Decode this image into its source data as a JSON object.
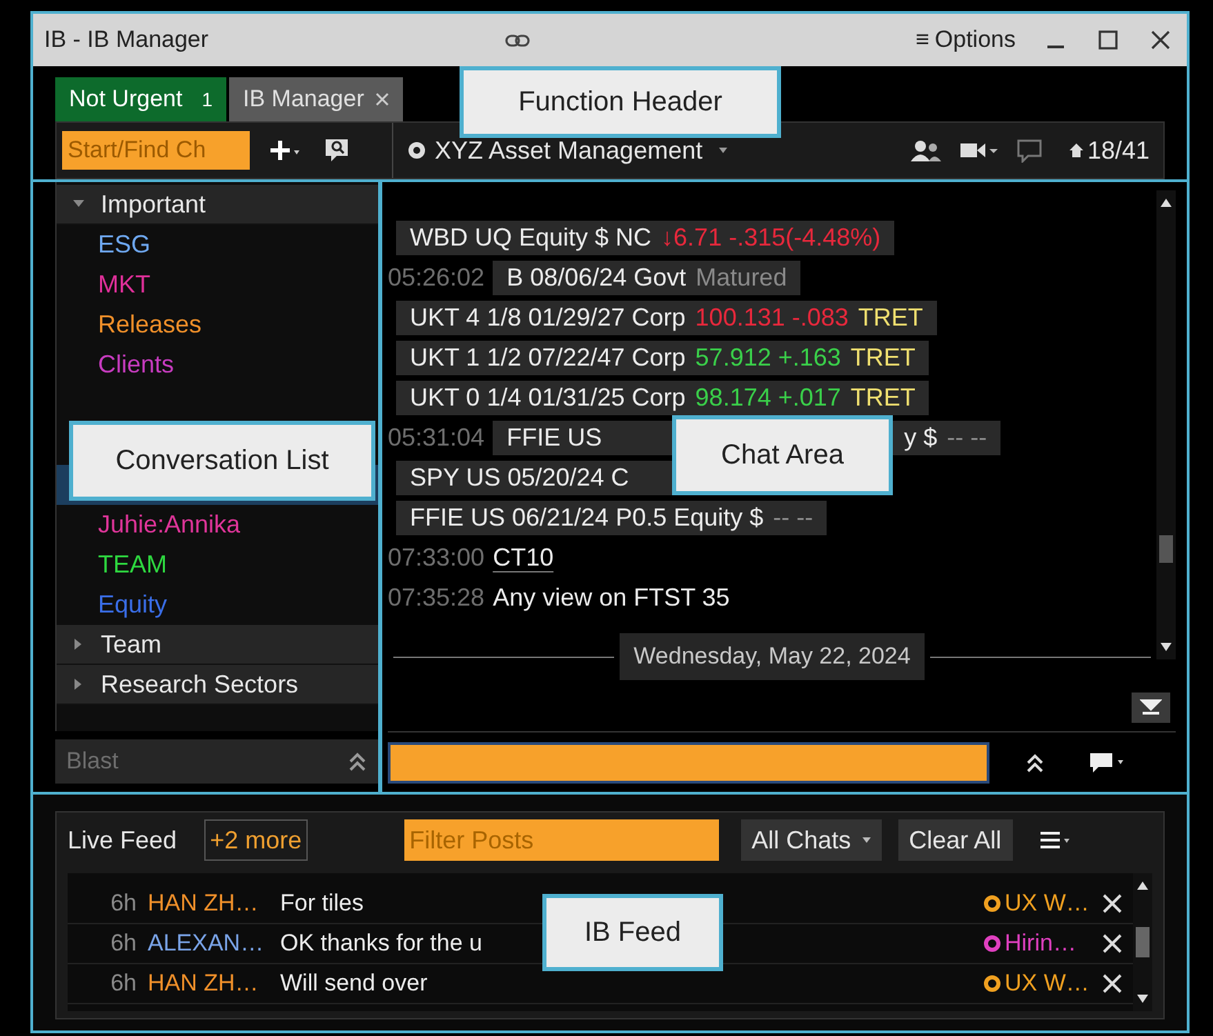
{
  "window": {
    "title": "IB - IB Manager",
    "menu_glyph": "≡",
    "options": "Options"
  },
  "tabs": [
    {
      "label": "Not Urgent",
      "count": "1",
      "kind": "badge"
    },
    {
      "label": "IB Manager",
      "kind": "function"
    }
  ],
  "toolbar": {
    "search_placeholder": "Start/Find Ch"
  },
  "chat_header": {
    "title": "XYZ Asset Management",
    "counter": "18/41"
  },
  "conversation_list": {
    "groups": [
      {
        "label": "Important",
        "expanded": true,
        "children": [
          {
            "kind": "chat",
            "label": "ESG",
            "color": "#6fa8f0",
            "selected": false
          },
          {
            "kind": "chat",
            "label": "MKT",
            "color": "#e0309a",
            "selected": false
          },
          {
            "kind": "chat",
            "label": "Releases",
            "color": "#f0902a",
            "selected": false
          },
          {
            "kind": "chat",
            "label": "Clients",
            "color": "#c83cc0",
            "selected": false
          },
          {
            "kind": "hidden"
          },
          {
            "kind": "chat",
            "selected": true
          },
          {
            "kind": "chat",
            "label": "Juhie:Annika",
            "color": "#e0359a",
            "selected": false
          },
          {
            "kind": "chat",
            "label": "TEAM",
            "color": "#2ed840",
            "selected": false
          },
          {
            "kind": "chat",
            "label": "Equity",
            "color": "#3a6ee8",
            "selected": false
          }
        ]
      },
      {
        "label": "Team",
        "expanded": false
      },
      {
        "label": "Research Sectors",
        "expanded": false
      }
    ],
    "blast_placeholder": "Blast"
  },
  "messages": [
    {
      "kind": "quote",
      "segments": [
        {
          "text": "WBD  UQ Equity $  NC",
          "kind": "security"
        },
        {
          "text": "↓6.71 -.315(-4.48%)",
          "kind": "down"
        }
      ]
    },
    {
      "time": "05:26:02",
      "kind": "quote",
      "segments": [
        {
          "text": "B 08/06/24 Govt",
          "kind": "security"
        },
        {
          "text": "Matured",
          "kind": "muted"
        }
      ]
    },
    {
      "kind": "quote",
      "segments": [
        {
          "text": "UKT 4 1/8 01/29/27 Corp",
          "kind": "security"
        },
        {
          "text": "100.131 -.083",
          "kind": "down"
        },
        {
          "text": "TRET",
          "kind": "tag"
        }
      ]
    },
    {
      "kind": "quote",
      "segments": [
        {
          "text": "UKT 1 1/2 07/22/47 Corp",
          "kind": "security"
        },
        {
          "text": "57.912 +.163",
          "kind": "up"
        },
        {
          "text": "TRET",
          "kind": "tag"
        }
      ]
    },
    {
      "kind": "quote",
      "segments": [
        {
          "text": "UKT 0 1/4 01/31/25 Corp",
          "kind": "security"
        },
        {
          "text": "98.174 +.017",
          "kind": "up"
        },
        {
          "text": "TRET",
          "kind": "tag"
        }
      ]
    },
    {
      "time": "05:31:04",
      "kind": "quote",
      "segments": [
        {
          "text": "FFIE US",
          "kind": "security"
        },
        {
          "text": "y $",
          "kind": "security",
          "gap_before": true
        },
        {
          "text": "-- --",
          "kind": "muted"
        }
      ]
    },
    {
      "kind": "quote",
      "covered_tail": true,
      "segments": [
        {
          "text": "SPY US 05/20/24 C",
          "kind": "security"
        }
      ]
    },
    {
      "kind": "quote",
      "segments": [
        {
          "text": "FFIE US 06/21/24 P0.5 Equity $",
          "kind": "security"
        },
        {
          "text": "-- --",
          "kind": "muted"
        }
      ]
    },
    {
      "time": "07:33:00",
      "kind": "link",
      "segments": [
        {
          "text": "CT10",
          "kind": "security"
        }
      ]
    },
    {
      "time": "07:35:28",
      "kind": "text",
      "segments": [
        {
          "text": "Any view on FTST 35",
          "kind": "security"
        }
      ]
    }
  ],
  "date_separator": "Wednesday, May 22, 2024",
  "feed": {
    "title": "Live Feed",
    "more": "+2 more",
    "filter_placeholder": "Filter Posts",
    "chats_button": "All Chats",
    "clear_button": "Clear All",
    "rows": [
      {
        "age": "6h",
        "sender": {
          "name": "HAN ZH…",
          "color": "#f0902a"
        },
        "text": "For tiles",
        "room": {
          "name": "UX W…",
          "color": "#f0a020"
        }
      },
      {
        "age": "6h",
        "sender": {
          "name": "ALEXAN…",
          "color": "#7aa4e8"
        },
        "text": "OK thanks for the u",
        "room": {
          "name": "Hirin…",
          "color": "#e040c0"
        }
      },
      {
        "age": "6h",
        "sender": {
          "name": "HAN ZH…",
          "color": "#f0902a"
        },
        "text": "Will send over",
        "room": {
          "name": "UX W…",
          "color": "#f0a020"
        }
      }
    ]
  },
  "callouts": [
    {
      "label": "Function Header"
    },
    {
      "label": "Conversation List"
    },
    {
      "label": "Chat Area"
    },
    {
      "label": "IB Feed"
    }
  ]
}
